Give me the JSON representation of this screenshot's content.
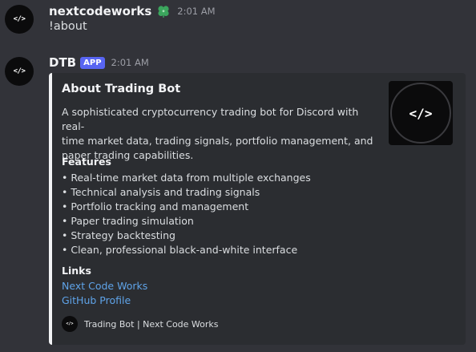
{
  "messages": [
    {
      "avatar_text": "</>",
      "username": "nextcodeworks",
      "badge_icon": "clover-icon",
      "timestamp": "2:01 AM",
      "text": "!about"
    },
    {
      "avatar_text": "</>",
      "username": "DTB",
      "app_badge": "APP",
      "timestamp": "2:01 AM"
    }
  ],
  "embed": {
    "accent_color": "#f2f3f5",
    "title": "About Trading Bot",
    "description_lines": [
      "A sophisticated cryptocurrency trading bot for Discord with real-",
      "time market data, trading signals, portfolio management, and",
      "paper trading capabilities."
    ],
    "thumbnail_text": "</>",
    "features": {
      "name": "Features",
      "items": [
        "Real-time market data from multiple exchanges",
        "Technical analysis and trading signals",
        "Portfolio tracking and management",
        "Paper trading simulation",
        "Strategy backtesting",
        "Clean, professional black-and-white interface"
      ]
    },
    "links": {
      "name": "Links",
      "items": [
        "Next Code Works",
        "GitHub Profile"
      ]
    },
    "footer": {
      "icon_text": "</>",
      "text": "Trading Bot | Next Code Works"
    }
  }
}
